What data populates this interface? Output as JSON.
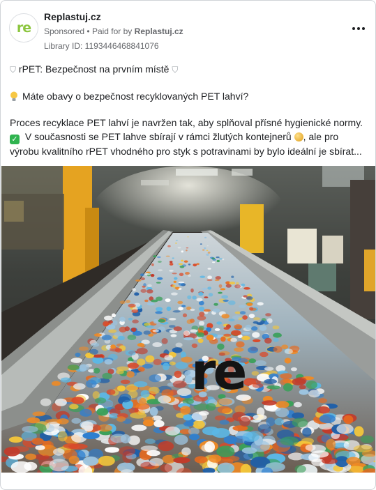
{
  "advertiser": {
    "name": "Replastuj.cz",
    "avatar_text": "re",
    "sponsored_label": "Sponsored",
    "paid_for_prefix": "Paid for by",
    "paid_for_name": "Replastuj.cz",
    "library_id": "Library ID: 1193446468841076"
  },
  "post": {
    "headline": "rPET: Bezpečnost na prvním místě",
    "question": "Máte obavy o bezpečnost recyklovaných PET lahví?",
    "paragraph_line1": "Proces recyklace PET lahví je navržen tak, aby splňoval přísné hygienické normy.",
    "paragraph_line2_a": "V současnosti se PET lahve sbírají v rámci žlutých kontejnerů",
    "paragraph_line2_b": ", ale pro",
    "paragraph_line3": "výrobu kvalitního rPET vhodného pro styk s potravinami by bylo ideální je sbírat..."
  },
  "image": {
    "logo_text": "re",
    "icon": "conveyor-belt-of-plastic-bottles"
  },
  "colors": {
    "brand_green": "#8cc63f",
    "text_primary": "#1c1e21",
    "text_secondary": "#65676b"
  }
}
